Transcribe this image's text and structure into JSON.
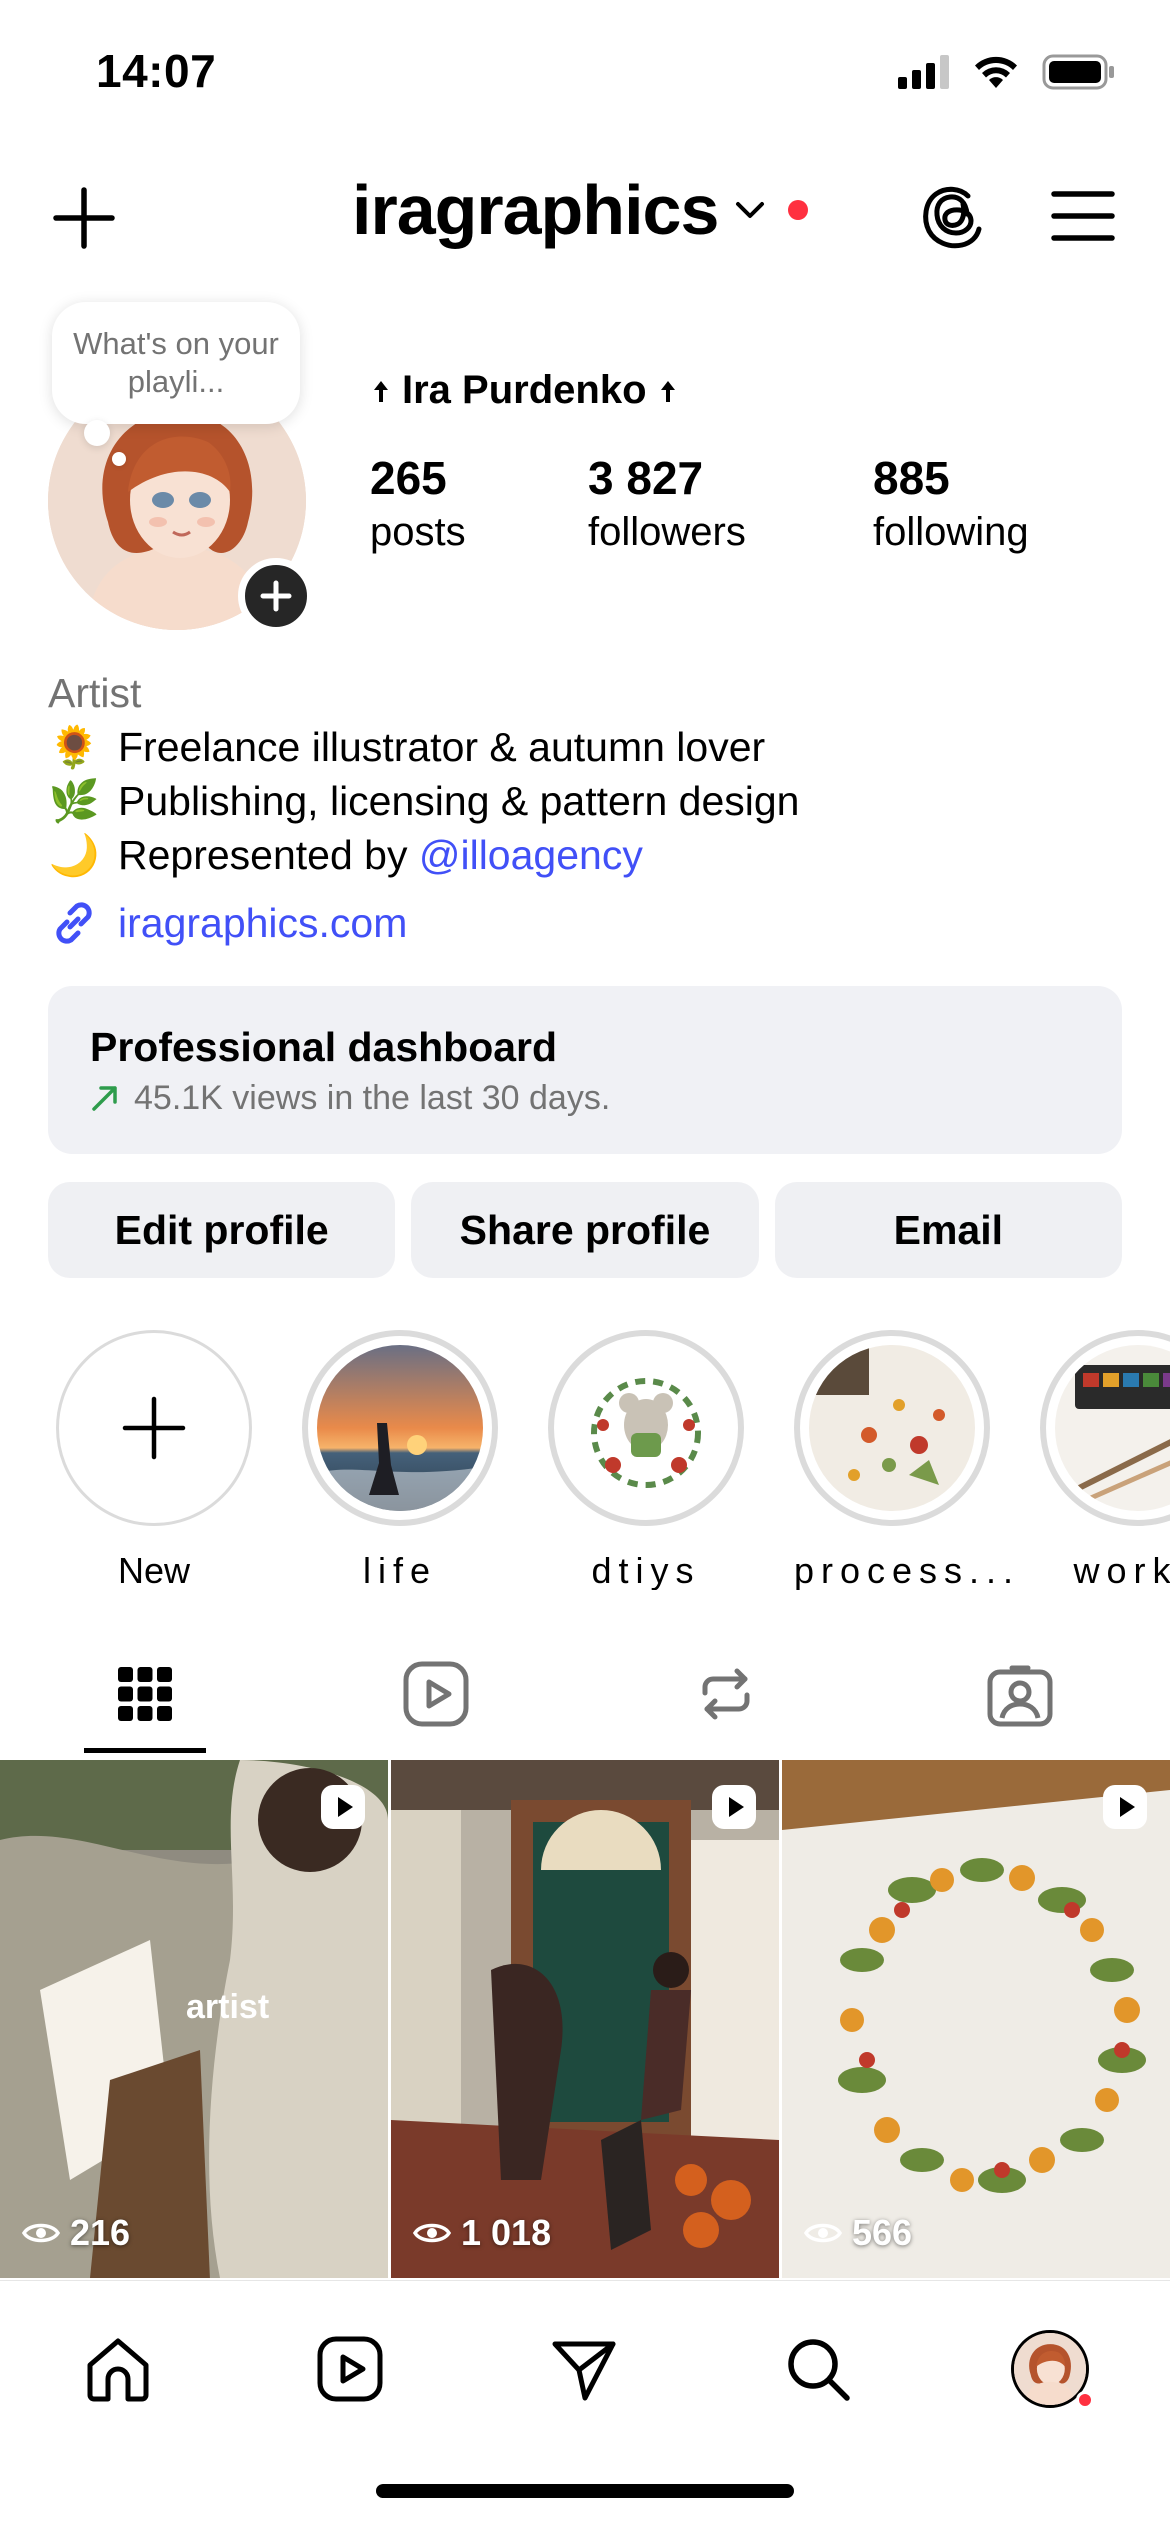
{
  "status_bar": {
    "time": "14:07",
    "icons": [
      "signal-icon",
      "wifi-icon",
      "battery-icon"
    ]
  },
  "header": {
    "username": "iragraphics",
    "icons": [
      "plus-icon",
      "chevron-down-icon",
      "threads-icon",
      "menu-icon"
    ],
    "notification_dot_color": "#ff3040"
  },
  "profile": {
    "note": "What's on your playli...",
    "display_name": "Ira Purdenko",
    "stats": [
      {
        "value": "265",
        "label": "posts"
      },
      {
        "value": "3 827",
        "label": "followers"
      },
      {
        "value": "885",
        "label": "following"
      }
    ],
    "category": "Artist",
    "bio_lines": [
      {
        "emoji": "🌻",
        "text": "Freelance illustrator & autumn lover"
      },
      {
        "emoji": "🌿",
        "text": "Publishing, licensing & pattern design"
      },
      {
        "emoji": "🌙",
        "text_before": "Represented by ",
        "mention": "@illoagency"
      }
    ],
    "link": "iragraphics.com",
    "link_color": "#4150f7"
  },
  "dashboard": {
    "title": "Professional dashboard",
    "subtitle": "45.1K views in the last 30 days."
  },
  "buttons": {
    "edit": "Edit profile",
    "share": "Share profile",
    "email": "Email"
  },
  "highlights": [
    {
      "label": "New"
    },
    {
      "label": "life"
    },
    {
      "label": "dtiys"
    },
    {
      "label": "process..."
    },
    {
      "label": "works"
    }
  ],
  "tabs": [
    "grid-icon",
    "reels-icon",
    "reposts-icon",
    "tagged-icon"
  ],
  "grid": [
    {
      "views": "216",
      "overlay_text": "artist"
    },
    {
      "views": "1 018"
    },
    {
      "views": "566"
    }
  ],
  "bottom_nav": [
    "home-icon",
    "reels-icon",
    "send-icon",
    "search-icon",
    "profile-avatar"
  ]
}
